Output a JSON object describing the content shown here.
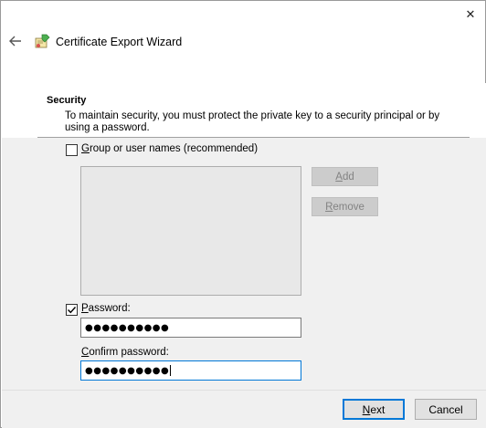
{
  "window": {
    "title": "Certificate Export Wizard",
    "close_glyph": "✕",
    "back_glyph": "←"
  },
  "section": {
    "title": "Security",
    "description": "To maintain security, you must protect the private key to a security principal or by using a password."
  },
  "group_option": {
    "label": "Group or user names (recommended)",
    "checked": false
  },
  "list_buttons": {
    "add": "Add",
    "remove": "Remove"
  },
  "password": {
    "label": "Password:",
    "checked": true,
    "value": "●●●●●●●●●●"
  },
  "confirm_password": {
    "label": "Confirm password:",
    "value": "●●●●●●●●●●"
  },
  "footer": {
    "next": "Next",
    "cancel": "Cancel"
  },
  "colors": {
    "accent": "#0078d7",
    "disabled_text": "#838383"
  },
  "icons": [
    "close-icon",
    "back-arrow-icon",
    "certificate-icon",
    "checkmark-icon"
  ]
}
